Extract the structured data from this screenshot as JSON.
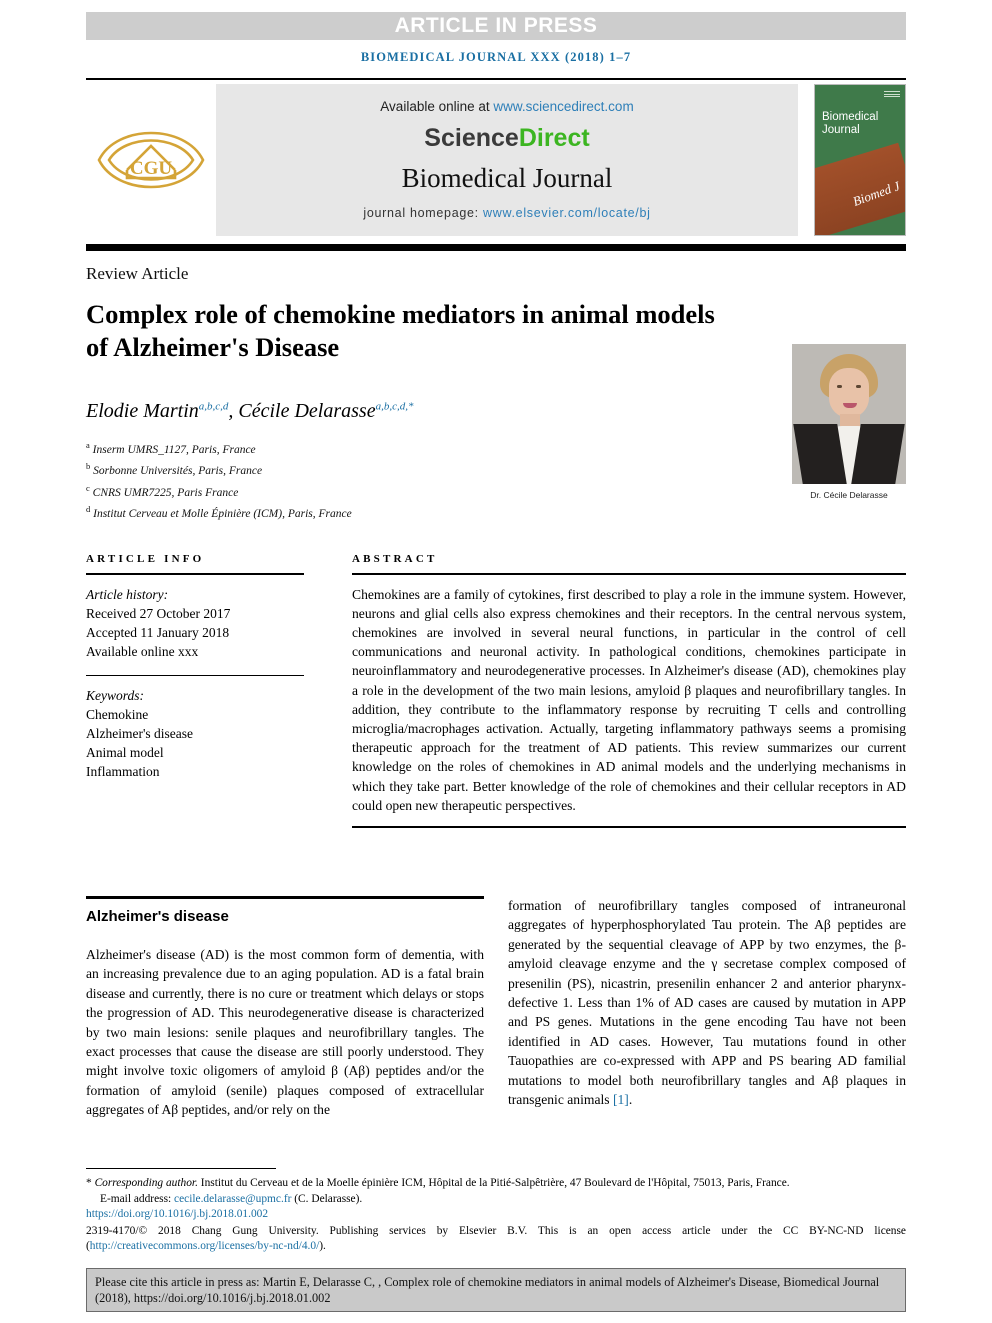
{
  "banner": {
    "text": "ARTICLE IN PRESS"
  },
  "journal_ref": "BIOMEDICAL JOURNAL XXX (2018) 1–7",
  "masthead": {
    "logo_text": "CGU",
    "available_prefix": "Available online at ",
    "available_url": "www.sciencedirect.com",
    "sciencedirect_part1": "Science",
    "sciencedirect_part2": "Direct",
    "journal_title": "Biomedical Journal",
    "homepage_label": "journal homepage: ",
    "homepage_url": "www.elsevier.com/locate/bj",
    "cover_line1": "Biomedical",
    "cover_line2": "Journal",
    "cover_script": "Biomed J"
  },
  "article": {
    "kicker": "Review Article",
    "title": "Complex role of chemokine mediators in animal models of Alzheimer's Disease",
    "author1": "Elodie Martin",
    "author1_sup": "a,b,c,d",
    "author_sep": ", ",
    "author2": "Cécile Delarasse",
    "author2_sup": "a,b,c,d,*",
    "affiliations": [
      {
        "mark": "a",
        "text": "Inserm UMRS_1127, Paris, France"
      },
      {
        "mark": "b",
        "text": "Sorbonne Universités, Paris, France"
      },
      {
        "mark": "c",
        "text": "CNRS UMR7225, Paris France"
      },
      {
        "mark": "d",
        "text": "Institut Cerveau et Molle Épinière (ICM), Paris, France"
      }
    ],
    "portrait_caption": "Dr. Cécile Delarasse"
  },
  "article_info": {
    "heading": "ARTICLE INFO",
    "history_label": "Article history:",
    "received": "Received 27 October 2017",
    "accepted": "Accepted 11 January 2018",
    "available": "Available online xxx",
    "keywords_label": "Keywords:",
    "keywords": [
      "Chemokine",
      "Alzheimer's disease",
      "Animal model",
      "Inflammation"
    ]
  },
  "abstract": {
    "heading": "ABSTRACT",
    "text": "Chemokines are a family of cytokines, first described to play a role in the immune system. However, neurons and glial cells also express chemokines and their receptors. In the central nervous system, chemokines are involved in several neural functions, in particular in the control of cell communications and neuronal activity. In pathological conditions, chemokines participate in neuroinflammatory and neurodegenerative processes. In Alzheimer's disease (AD), chemokines play a role in the development of the two main lesions, amyloid β plaques and neurofibrillary tangles. In addition, they contribute to the inflammatory response by recruiting T cells and controlling microglia/macrophages activation. Actually, targeting inflammatory pathways seems a promising therapeutic approach for the treatment of AD patients. This review summarizes our current knowledge on the roles of chemokines in AD animal models and the underlying mechanisms in which they take part. Better knowledge of the role of chemokines and their cellular receptors in AD could open new therapeutic perspectives."
  },
  "body": {
    "section_heading": "Alzheimer's disease",
    "left_column": "Alzheimer's disease (AD) is the most common form of dementia, with an increasing prevalence due to an aging population. AD is a fatal brain disease and currently, there is no cure or treatment which delays or stops the progression of AD. This neurodegenerative disease is characterized by two main lesions: senile plaques and neurofibrillary tangles. The exact processes that cause the disease are still poorly understood. They might involve toxic oligomers of amyloid β (Aβ) peptides and/or the formation of amyloid (senile) plaques composed of extracellular aggregates of Aβ peptides, and/or rely on the",
    "right_column_pre": "formation of neurofibrillary tangles composed of intraneuronal aggregates of hyperphosphorylated Tau protein. The Aβ peptides are generated by the sequential cleavage of APP by two enzymes, the β-amyloid cleavage enzyme and the γ secretase complex composed of presenilin (PS), nicastrin, presenilin enhancer 2 and anterior pharynx-defective 1. Less than 1% of AD cases are caused by mutation in APP and PS genes. Mutations in the gene encoding Tau have not been identified in AD cases. However, Tau mutations found in other Tauopathies are co-expressed with APP and PS bearing AD familial mutations to model both neurofibrillary tangles and Aβ plaques in transgenic animals ",
    "right_column_ref": "[1]",
    "right_column_post": "."
  },
  "footnotes": {
    "corresponding_mark": "*",
    "corresponding_label": "Corresponding author.",
    "corresponding_address": " Institut du Cerveau et de la Moelle épinière ICM, Hôpital de la Pitié-Salpêtrière, 47 Boulevard de l'Hôpital, 75013, Paris, France.",
    "email_label": "E-mail address: ",
    "email": "cecile.delarasse@upmc.fr",
    "email_suffix": " (C. Delarasse).",
    "doi": "https://doi.org/10.1016/j.bj.2018.01.002",
    "copyright_pre": "2319-4170/© 2018 Chang Gung University. Publishing services by Elsevier B.V. This is an open access article under the CC BY-NC-ND license (",
    "license_url": "http://creativecommons.org/licenses/by-nc-nd/4.0/",
    "copyright_post": ")."
  },
  "cite_box": {
    "text": "Please cite this article in press as: Martin E, Delarasse C, , Complex role of chemokine mediators in animal models of Alzheimer's Disease, Biomedical Journal (2018), https://doi.org/10.1016/j.bj.2018.01.002"
  },
  "colors": {
    "link_blue": "#1a6fa3",
    "sciencedirect_green": "#3cb521",
    "banner_gray": "#cdcdcd",
    "cover_green": "#3f7a4a",
    "logo_gold": "#d4a437"
  }
}
